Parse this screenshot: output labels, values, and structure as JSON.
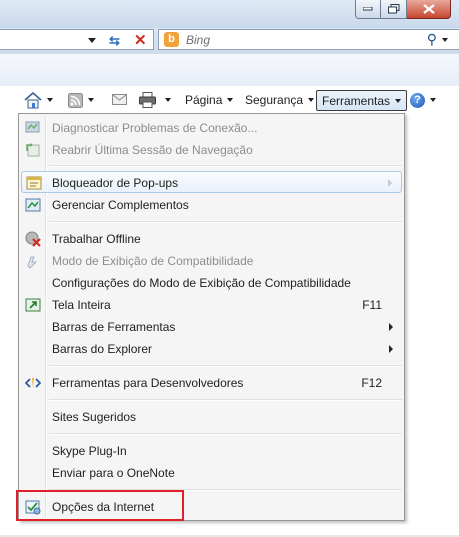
{
  "search": {
    "engine": "Bing",
    "placeholder": "Bing"
  },
  "command_bar": {
    "page_label": "Página",
    "safety_label": "Segurança",
    "tools_label": "Ferramentas"
  },
  "menu": {
    "items": [
      {
        "label": "Diagnosticar Problemas de Conexão...",
        "icon": "diagnose-icon",
        "disabled": true
      },
      {
        "label": "Reabrir Última Sessão de Navegação",
        "icon": "reopen-session-icon",
        "disabled": true
      },
      {
        "label": "Bloqueador de Pop-ups",
        "icon": "popup-blocker-icon",
        "submenu": true,
        "highlighted": true
      },
      {
        "label": "Gerenciar Complementos",
        "icon": "addons-icon"
      },
      {
        "label": "Trabalhar Offline",
        "icon": "offline-icon"
      },
      {
        "label": "Modo de Exibição de Compatibilidade",
        "icon": "compat-view-icon",
        "disabled": true
      },
      {
        "label": "Configurações do Modo de Exibição de Compatibilidade"
      },
      {
        "label": "Tela Inteira",
        "icon": "fullscreen-icon",
        "shortcut": "F11"
      },
      {
        "label": "Barras de Ferramentas",
        "submenu": true
      },
      {
        "label": "Barras do Explorer",
        "submenu": true
      },
      {
        "label": "Ferramentas para Desenvolvedores",
        "icon": "developer-tools-icon",
        "shortcut": "F12"
      },
      {
        "label": "Sites Sugeridos"
      },
      {
        "label": "Skype Plug-In"
      },
      {
        "label": "Enviar para o OneNote"
      },
      {
        "label": "Opções da Internet",
        "icon": "internet-options-icon"
      }
    ]
  },
  "colors": {
    "highlight_box": "#e0202a",
    "menu_bg": "#f5f5f5",
    "toolbar_bg": "#dce7f3"
  }
}
